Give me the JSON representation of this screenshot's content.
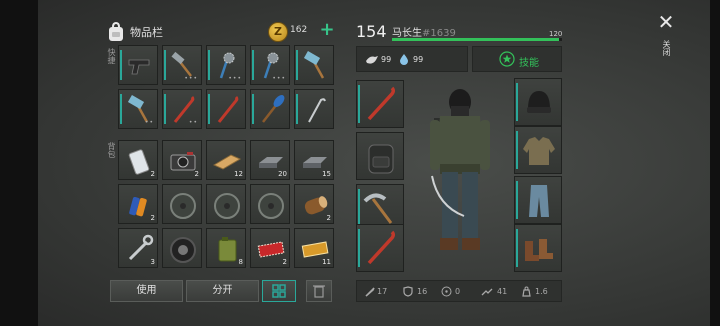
{
  "inventory": {
    "title": "物品栏",
    "coins": "162",
    "labels": {
      "quick": "快捷",
      "backpack": "背包"
    },
    "quick_slots": [
      {
        "icon": "pistol-icon",
        "count": ""
      },
      {
        "icon": "hammer-icon",
        "count": ""
      },
      {
        "icon": "spiked-mace-icon",
        "count": ""
      },
      {
        "icon": "spiked-mace-icon",
        "count": ""
      },
      {
        "icon": "sledgehammer-icon",
        "count": ""
      },
      {
        "icon": "sledgehammer-icon",
        "count": ""
      },
      {
        "icon": "crowbar-icon",
        "count": ""
      },
      {
        "icon": "crowbar-icon",
        "count": ""
      },
      {
        "icon": "oar-icon",
        "count": ""
      },
      {
        "icon": "hook-icon",
        "count": ""
      }
    ],
    "backpack_slots": [
      {
        "icon": "phone-icon",
        "count": "2"
      },
      {
        "icon": "camera-icon",
        "count": "2"
      },
      {
        "icon": "wood-plank-icon",
        "count": "12"
      },
      {
        "icon": "iron-ingot-icon",
        "count": "20"
      },
      {
        "icon": "iron-ingot-icon",
        "count": "15"
      },
      {
        "icon": "battery-icon",
        "count": "2"
      },
      {
        "icon": "disc-icon",
        "count": ""
      },
      {
        "icon": "disc-icon",
        "count": ""
      },
      {
        "icon": "disc-icon",
        "count": ""
      },
      {
        "icon": "log-icon",
        "count": "2"
      },
      {
        "icon": "wrench-icon",
        "count": "3"
      },
      {
        "icon": "tire-icon",
        "count": ""
      },
      {
        "icon": "jerry-can-icon",
        "count": "8"
      },
      {
        "icon": "red-ticket-icon",
        "count": "2"
      },
      {
        "icon": "gold-ticket-icon",
        "count": "11"
      }
    ],
    "buttons": {
      "use": "使用",
      "split": "分开"
    }
  },
  "character": {
    "level": "154",
    "name": "马长生",
    "id": "#1639",
    "xp_max": "120",
    "xp_fraction": 0.98,
    "food": "99",
    "water": "99",
    "skills_label": "技能",
    "stats": [
      {
        "icon": "attack-icon",
        "value": "17"
      },
      {
        "icon": "armor-icon",
        "value": "16"
      },
      {
        "icon": "radiation-icon",
        "value": "0"
      },
      {
        "icon": "speed-icon",
        "value": "41"
      },
      {
        "icon": "weight-icon",
        "value": "1.6"
      }
    ]
  },
  "close": {
    "label": "关闭"
  },
  "colors": {
    "accent": "#2aa89a",
    "green": "#33c15a",
    "coin": "#e0b040"
  }
}
